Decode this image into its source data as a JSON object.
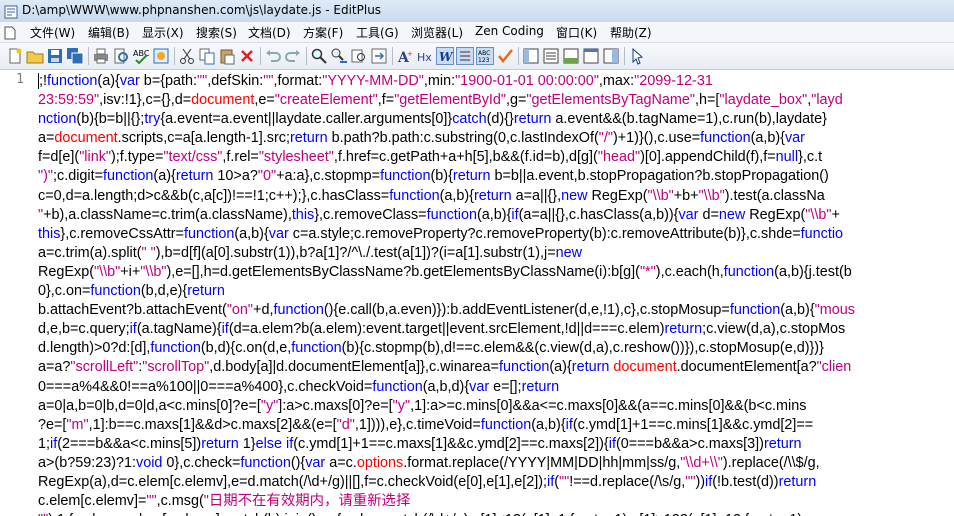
{
  "window": {
    "title": "D:\\amp\\WWW\\www.phpnanshen.com\\js\\laydate.js - EditPlus"
  },
  "menu": {
    "items": [
      "文件(W)",
      "编辑(B)",
      "显示(X)",
      "搜索(S)",
      "文档(D)",
      "方案(F)",
      "工具(G)",
      "浏览器(L)",
      "Zen Coding",
      "窗口(K)",
      "帮助(Z)"
    ]
  },
  "toolbar": {
    "buttons": [
      "new-document",
      "open",
      "save",
      "save-all",
      "print",
      "print-preview",
      "spell-check",
      "cut",
      "copy",
      "paste",
      "delete",
      "undo",
      "redo",
      "find",
      "replace",
      "find-next",
      "go-to-line",
      "font",
      "hex",
      "word-wrap",
      "line-number",
      "column-ruler",
      "check",
      "cliptext",
      "directory",
      "output",
      "browser",
      "function-list",
      "cursor-tool"
    ]
  },
  "colors": {
    "keyword": "#0000ff",
    "string": "#c0007e",
    "builtin": "#ff0000",
    "text": "#000000",
    "gutter": "#7f7f7f"
  },
  "editor": {
    "line_number": "1",
    "lines": [
      [
        [
          "t",
          ";!"
        ],
        [
          "k",
          "function"
        ],
        [
          "t",
          "(a){"
        ],
        [
          "k",
          "var"
        ],
        [
          "t",
          " b={path:"
        ],
        [
          "s",
          "\"\""
        ],
        [
          "t",
          ",defSkin:"
        ],
        [
          "s",
          "\"\""
        ],
        [
          "t",
          ",format:"
        ],
        [
          "s",
          "\"YYYY-MM-DD\""
        ],
        [
          "t",
          ",min:"
        ],
        [
          "s",
          "\"1900-01-01 00:00:00\""
        ],
        [
          "t",
          ",max:"
        ],
        [
          "s",
          "\"2099-12-31"
        ]
      ],
      [
        [
          "s",
          "23:59:59\""
        ],
        [
          "t",
          ",isv:!1},c={},d="
        ],
        [
          "r",
          "document"
        ],
        [
          "t",
          ",e="
        ],
        [
          "s",
          "\"createElement\""
        ],
        [
          "t",
          ",f="
        ],
        [
          "s",
          "\"getElementById\""
        ],
        [
          "t",
          ",g="
        ],
        [
          "s",
          "\"getElementsByTagName\""
        ],
        [
          "t",
          ",h=["
        ],
        [
          "s",
          "\"laydate_box\""
        ],
        [
          "t",
          ","
        ],
        [
          "s",
          "\"layd"
        ]
      ],
      [
        [
          "k",
          "nction"
        ],
        [
          "t",
          "(b){b=b||{};"
        ],
        [
          "k",
          "try"
        ],
        [
          "t",
          "{a.event=a.event||laydate.caller.arguments[0]}"
        ],
        [
          "k",
          "catch"
        ],
        [
          "t",
          "(d){}"
        ],
        [
          "k",
          "return"
        ],
        [
          "t",
          " a.event&&(b.tagName=1),c.run(b),laydate}"
        ]
      ],
      [
        [
          "t",
          "a="
        ],
        [
          "r",
          "document"
        ],
        [
          "t",
          ".scripts,c=a[a.length-1].src;"
        ],
        [
          "k",
          "return"
        ],
        [
          "t",
          " b.path?b.path:c.substring(0,c.lastIndexOf("
        ],
        [
          "s",
          "\"/\""
        ],
        [
          "t",
          ")+1)}(),c.use="
        ],
        [
          "k",
          "function"
        ],
        [
          "t",
          "(a,b){"
        ],
        [
          "k",
          "var"
        ]
      ],
      [
        [
          "t",
          "f=d[e]("
        ],
        [
          "s",
          "\"link\""
        ],
        [
          "t",
          ");f.type="
        ],
        [
          "s",
          "\"text/css\""
        ],
        [
          "t",
          ",f.rel="
        ],
        [
          "s",
          "\"stylesheet\""
        ],
        [
          "t",
          ",f.href=c.getPath+a+h[5],b&&(f.id=b),d[g]("
        ],
        [
          "s",
          "\"head\""
        ],
        [
          "t",
          ")[0].appendChild(f),f="
        ],
        [
          "k",
          "null"
        ],
        [
          "t",
          "},c.t"
        ]
      ],
      [
        [
          "s",
          "\")\""
        ],
        [
          "t",
          ";c.digit="
        ],
        [
          "k",
          "function"
        ],
        [
          "t",
          "(a){"
        ],
        [
          "k",
          "return"
        ],
        [
          "t",
          " 10>a?"
        ],
        [
          "s",
          "\"0\""
        ],
        [
          "t",
          "+a:a},c.stopmp="
        ],
        [
          "k",
          "function"
        ],
        [
          "t",
          "(b){"
        ],
        [
          "k",
          "return"
        ],
        [
          "t",
          " b=b||a.event,b.stopPropagation?b.stopPropagation()"
        ]
      ],
      [
        [
          "t",
          "c=0,d=a.length;d>c&&b(c,a[c])!==!1;c++);},c.hasClass="
        ],
        [
          "k",
          "function"
        ],
        [
          "t",
          "(a,b){"
        ],
        [
          "k",
          "return"
        ],
        [
          "t",
          " a=a||{},"
        ],
        [
          "k",
          "new"
        ],
        [
          "t",
          " RegExp("
        ],
        [
          "s",
          "\"\\\\b\""
        ],
        [
          "t",
          "+b+"
        ],
        [
          "s",
          "\"\\\\b\""
        ],
        [
          "t",
          ").test(a.classNa"
        ]
      ],
      [
        [
          "s",
          "\""
        ],
        [
          "t",
          "+b),a.className=c.trim(a.className),"
        ],
        [
          "k",
          "this"
        ],
        [
          "t",
          "},c.removeClass="
        ],
        [
          "k",
          "function"
        ],
        [
          "t",
          "(a,b){"
        ],
        [
          "k",
          "if"
        ],
        [
          "t",
          "(a=a||{},c.hasClass(a,b)){"
        ],
        [
          "k",
          "var"
        ],
        [
          "t",
          " d="
        ],
        [
          "k",
          "new"
        ],
        [
          "t",
          " RegExp("
        ],
        [
          "s",
          "\"\\\\b\""
        ],
        [
          "t",
          "+"
        ]
      ],
      [
        [
          "k",
          "this"
        ],
        [
          "t",
          "},c.removeCssAttr="
        ],
        [
          "k",
          "function"
        ],
        [
          "t",
          "(a,b){"
        ],
        [
          "k",
          "var"
        ],
        [
          "t",
          " c=a.style;c.removeProperty?c.removeProperty(b):c.removeAttribute(b)},c.shde="
        ],
        [
          "k",
          "functio"
        ]
      ],
      [
        [
          "t",
          "a=c.trim(a).split("
        ],
        [
          "s",
          "\" \""
        ],
        [
          "t",
          "),b=d[f](a[0].substr(1)),b?a[1]?/^\\./.test(a[1])?(i=a[1].substr(1),j="
        ],
        [
          "k",
          "new"
        ]
      ],
      [
        [
          "t",
          "RegExp("
        ],
        [
          "s",
          "\"\\\\b\""
        ],
        [
          "t",
          "+i+"
        ],
        [
          "s",
          "\"\\\\b\""
        ],
        [
          "t",
          "),e=[],h=d.getElementsByClassName?b.getElementsByClassName(i):b[g]("
        ],
        [
          "s",
          "\"*\""
        ],
        [
          "t",
          "),c.each(h,"
        ],
        [
          "k",
          "function"
        ],
        [
          "t",
          "(a,b){j.test(b"
        ]
      ],
      [
        [
          "t",
          "0},c.on="
        ],
        [
          "k",
          "function"
        ],
        [
          "t",
          "(b,d,e){"
        ],
        [
          "k",
          "return"
        ]
      ],
      [
        [
          "t",
          "b.attachEvent?b.attachEvent("
        ],
        [
          "s",
          "\"on\""
        ],
        [
          "t",
          "+d,"
        ],
        [
          "k",
          "function"
        ],
        [
          "t",
          "(){e.call(b,a.even)}):b.addEventListener(d,e,!1),c},c.stopMosup="
        ],
        [
          "k",
          "function"
        ],
        [
          "t",
          "(a,b){"
        ],
        [
          "s",
          "\"mous"
        ]
      ],
      [
        [
          "t",
          "d,e,b=c.query;"
        ],
        [
          "k",
          "if"
        ],
        [
          "t",
          "(a.tagName){"
        ],
        [
          "k",
          "if"
        ],
        [
          "t",
          "(d=a.elem?b(a.elem):event.target||event.srcElement,!d||d===c.elem)"
        ],
        [
          "k",
          "return"
        ],
        [
          "t",
          ";c.view(d,a),c.stopMos"
        ]
      ],
      [
        [
          "t",
          "d.length)>0?d:[d],"
        ],
        [
          "k",
          "function"
        ],
        [
          "t",
          "(b,d){c.on(d,e,"
        ],
        [
          "k",
          "function"
        ],
        [
          "t",
          "(b){c.stopmp(b),d!==c.elem&&(c.view(d,a),c.reshow())}),c.stopMosup(e,d)})}"
        ]
      ],
      [
        [
          "t",
          "a=a?"
        ],
        [
          "s",
          "\"scrollLeft\""
        ],
        [
          "t",
          ":"
        ],
        [
          "s",
          "\"scrollTop\""
        ],
        [
          "t",
          ",d.body[a]|d.documentElement[a]},c.winarea="
        ],
        [
          "k",
          "function"
        ],
        [
          "t",
          "(a){"
        ],
        [
          "k",
          "return"
        ],
        [
          "t",
          " "
        ],
        [
          "r",
          "document"
        ],
        [
          "t",
          ".documentElement[a?"
        ],
        [
          "s",
          "\"clien"
        ]
      ],
      [
        [
          "t",
          "0===a%4&&0!==a%100||0===a%400},c.checkVoid="
        ],
        [
          "k",
          "function"
        ],
        [
          "t",
          "(a,b,d){"
        ],
        [
          "k",
          "var"
        ],
        [
          "t",
          " e=[];"
        ],
        [
          "k",
          "return"
        ]
      ],
      [
        [
          "t",
          "a=0|a,b=0|b,d=0|d,a<c.mins[0]?e=["
        ],
        [
          "s",
          "\"y\""
        ],
        [
          "t",
          "]:a>c.maxs[0]?e=["
        ],
        [
          "s",
          "\"y\""
        ],
        [
          "t",
          ",1]:a>=c.mins[0]&&a<=c.maxs[0]&&(a==c.mins[0]&&(b<c.mins"
        ]
      ],
      [
        [
          "t",
          "?e=["
        ],
        [
          "s",
          "\"m\""
        ],
        [
          "t",
          ",1]:b==c.maxs[1]&&d>c.maxs[2]&&(e=["
        ],
        [
          "s",
          "\"d\""
        ],
        [
          "t",
          ",1]))),e},c.timeVoid="
        ],
        [
          "k",
          "function"
        ],
        [
          "t",
          "(a,b){"
        ],
        [
          "k",
          "if"
        ],
        [
          "t",
          "(c.ymd[1]+1==c.mins[1]&&c.ymd[2]=="
        ]
      ],
      [
        [
          "t",
          "1;"
        ],
        [
          "k",
          "if"
        ],
        [
          "t",
          "(2===b&&a<c.mins[5])"
        ],
        [
          "k",
          "return"
        ],
        [
          "t",
          " 1}"
        ],
        [
          "k",
          "else"
        ],
        [
          "t",
          " "
        ],
        [
          "k",
          "if"
        ],
        [
          "t",
          "(c.ymd[1]+1==c.maxs[1]&&c.ymd[2]==c.maxs[2]){"
        ],
        [
          "k",
          "if"
        ],
        [
          "t",
          "(0===b&&a>c.maxs[3])"
        ],
        [
          "k",
          "return"
        ]
      ],
      [
        [
          "t",
          "a>(b?59:23)?1:"
        ],
        [
          "k",
          "void"
        ],
        [
          "t",
          " 0},c.check="
        ],
        [
          "k",
          "function"
        ],
        [
          "t",
          "(){"
        ],
        [
          "k",
          "var"
        ],
        [
          "t",
          " a=c."
        ],
        [
          "r",
          "options"
        ],
        [
          "t",
          ".format.replace(/YYYY|MM|DD|hh|mm|ss/g,"
        ],
        [
          "s",
          "\"\\\\d+\\\\\""
        ],
        [
          "t",
          ").replace(/\\\\$/g,"
        ]
      ],
      [
        [
          "t",
          "RegExp(a),d=c.elem[c.elemv],e=d.match(/\\d+/g)||[],f=c.checkVoid(e[0],e[1],e[2]);"
        ],
        [
          "k",
          "if"
        ],
        [
          "t",
          "("
        ],
        [
          "s",
          "\"\""
        ],
        [
          "t",
          "!==d.replace(/\\s/g,"
        ],
        [
          "s",
          "\"\""
        ],
        [
          "t",
          "))"
        ],
        [
          "k",
          "if"
        ],
        [
          "t",
          "(!b.test(d))"
        ],
        [
          "k",
          "return"
        ]
      ],
      [
        [
          "t",
          "c.elem[c.elemv]="
        ],
        [
          "s",
          "\"\""
        ],
        [
          "t",
          ",c.msg("
        ],
        [
          "s",
          "\"日期不在有效期内，请重新选择"
        ]
      ],
      [
        [
          "s",
          "\"\""
        ],
        [
          "t",
          "),1;f.value=c.elem[c.elemv].match(b).join(),e=f.value.match(/\\d+/g),e[1]<1?(e[1]=1,f.auto=1):e[1]>12?(e[1]=12,f.auto=1)"
        ]
      ]
    ]
  }
}
